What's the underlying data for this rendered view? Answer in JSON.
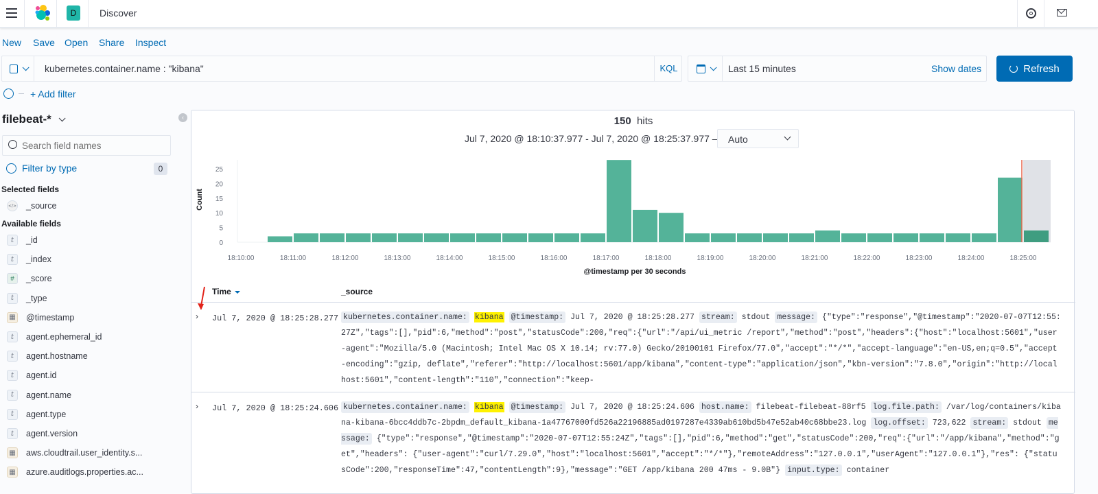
{
  "header": {
    "title": "Discover",
    "space_initial": "D",
    "space_color": "#20b5a8",
    "icons": [
      "menu-icon",
      "elastic-logo",
      "help-icon",
      "mail-icon"
    ]
  },
  "top_menu": [
    "New",
    "Save",
    "Open",
    "Share",
    "Inspect"
  ],
  "query": {
    "value": "kubernetes.container.name : \"kibana\"",
    "language": "KQL"
  },
  "time": {
    "value": "Last 15 minutes",
    "show_dates": "Show dates",
    "refresh": "Refresh"
  },
  "filters": {
    "add": "+ Add filter"
  },
  "sidebar": {
    "index_pattern": "filebeat-*",
    "search_placeholder": "Search field names",
    "filter_by_type": "Filter by type",
    "filter_count": "0",
    "selected_heading": "Selected fields",
    "selected": [
      {
        "name": "_source",
        "type": "source"
      }
    ],
    "available_heading": "Available fields",
    "available": [
      {
        "name": "_id",
        "type": "t"
      },
      {
        "name": "_index",
        "type": "t"
      },
      {
        "name": "_score",
        "type": "#"
      },
      {
        "name": "_type",
        "type": "t"
      },
      {
        "name": "@timestamp",
        "type": "date"
      },
      {
        "name": "agent.ephemeral_id",
        "type": "t"
      },
      {
        "name": "agent.hostname",
        "type": "t"
      },
      {
        "name": "agent.id",
        "type": "t"
      },
      {
        "name": "agent.name",
        "type": "t"
      },
      {
        "name": "agent.type",
        "type": "t"
      },
      {
        "name": "agent.version",
        "type": "t"
      },
      {
        "name": "aws.cloudtrail.user_identity.s...",
        "type": "date"
      },
      {
        "name": "azure.auditlogs.properties.ac...",
        "type": "date"
      }
    ]
  },
  "hits": {
    "count": "150",
    "label": "hits",
    "range": "Jul 7, 2020 @ 18:10:37.977 - Jul 7, 2020 @ 18:25:37.977 —",
    "interval": "Auto"
  },
  "chart_data": {
    "type": "bar",
    "xlabel": "@timestamp per 30 seconds",
    "ylabel": "Count",
    "ylim": [
      0,
      28
    ],
    "yticks": [
      0,
      5,
      10,
      15,
      20,
      25
    ],
    "xticks": [
      "18:10:00",
      "18:11:00",
      "18:12:00",
      "18:13:00",
      "18:14:00",
      "18:15:00",
      "18:16:00",
      "18:17:00",
      "18:18:00",
      "18:19:00",
      "18:20:00",
      "18:21:00",
      "18:22:00",
      "18:23:00",
      "18:24:00",
      "18:25:00"
    ],
    "categories": [
      "18:10:30",
      "18:11:00",
      "18:11:30",
      "18:12:00",
      "18:12:30",
      "18:13:00",
      "18:13:30",
      "18:14:00",
      "18:14:30",
      "18:15:00",
      "18:15:30",
      "18:16:00",
      "18:16:30",
      "18:17:00",
      "18:17:30",
      "18:18:00",
      "18:18:30",
      "18:19:00",
      "18:19:30",
      "18:20:00",
      "18:20:30",
      "18:21:00",
      "18:21:30",
      "18:22:00",
      "18:22:30",
      "18:23:00",
      "18:23:30",
      "18:24:00",
      "18:24:30",
      "18:25:00"
    ],
    "values": [
      2,
      3,
      3,
      3,
      3,
      3,
      3,
      3,
      3,
      3,
      3,
      3,
      3,
      28,
      11,
      10,
      3,
      3,
      3,
      3,
      3,
      4,
      3,
      3,
      3,
      3,
      3,
      3,
      22,
      4
    ],
    "bar_color": "#54b399",
    "now_marker": "18:25:00",
    "now_color": "#e7664c"
  },
  "table": {
    "headers": {
      "time": "Time",
      "source": "_source"
    },
    "rows": [
      {
        "time": "Jul 7, 2020 @ 18:25:28.277",
        "source": [
          {
            "k": "kubernetes.container.name:",
            "v": "kibana",
            "hl": true
          },
          {
            "k": "@timestamp:",
            "v": "Jul 7, 2020 @ 18:25:28.277"
          },
          {
            "k": "stream:",
            "v": "stdout"
          },
          {
            "k": "message:",
            "v": "{\"type\":\"response\",\"@timestamp\":\"2020-07-07T12:55:27Z\",\"tags\":[],\"pid\":6,\"method\":\"post\",\"statusCode\":200,\"req\":{\"url\":\"/api/ui_metric /report\",\"method\":\"post\",\"headers\":{\"host\":\"localhost:5601\",\"user-agent\":\"Mozilla/5.0 (Macintosh; Intel Mac OS X 10.14; rv:77.0) Gecko/20100101 Firefox/77.0\",\"accept\":\"*/*\",\"accept-language\":\"en-US,en;q=0.5\",\"accept-encoding\":\"gzip, deflate\",\"referer\":\"http://localhost:5601/app/kibana\",\"content-type\":\"application/json\",\"kbn-version\":\"7.8.0\",\"origin\":\"http://localhost:5601\",\"content-length\":\"110\",\"connection\":\"keep-"
          }
        ]
      },
      {
        "time": "Jul 7, 2020 @ 18:25:24.606",
        "source": [
          {
            "k": "kubernetes.container.name:",
            "v": "kibana",
            "hl": true
          },
          {
            "k": "@timestamp:",
            "v": "Jul 7, 2020 @ 18:25:24.606"
          },
          {
            "k": "host.name:",
            "v": "filebeat-filebeat-88rf5"
          },
          {
            "k": "log.file.path:",
            "v": "/var/log/containers/kibana-kibana-6bcc4ddb7c-2bpdm_default_kibana-1a47767000fd526a22196885ad0197287e4339ab610bd5b47e52ab40c68bbe23.log"
          },
          {
            "k": "log.offset:",
            "v": "723,622"
          },
          {
            "k": "stream:",
            "v": "stdout"
          },
          {
            "k": "message:",
            "v": "{\"type\":\"response\",\"@timestamp\":\"2020-07-07T12:55:24Z\",\"tags\":[],\"pid\":6,\"method\":\"get\",\"statusCode\":200,\"req\":{\"url\":\"/app/kibana\",\"method\":\"get\",\"headers\": {\"user-agent\":\"curl/7.29.0\",\"host\":\"localhost:5601\",\"accept\":\"*/*\"},\"remoteAddress\":\"127.0.0.1\",\"userAgent\":\"127.0.0.1\"},\"res\": {\"statusCode\":200,\"responseTime\":47,\"contentLength\":9},\"message\":\"GET /app/kibana 200 47ms - 9.0B\"}"
          },
          {
            "k": "input.type:",
            "v": "container"
          }
        ]
      }
    ]
  }
}
